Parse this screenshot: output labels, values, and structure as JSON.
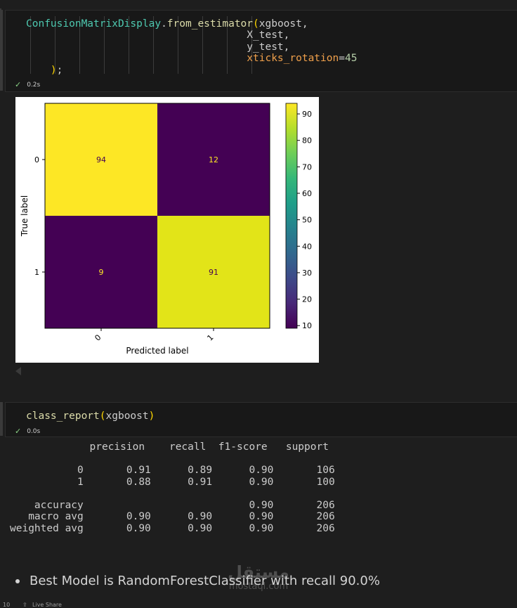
{
  "cell1": {
    "code_lines": [
      {
        "fn": "ConfusionMatrixDisplay",
        "dot": ".",
        "meth": "from_estimator",
        "paren": "(",
        "arg": "xgboost,"
      },
      {
        "arg": "X_test,"
      },
      {
        "arg": "y_test,"
      },
      {
        "kw": "xticks_rotation",
        "eq": "=",
        "num": "45"
      },
      {
        "paren": ")",
        "semi": ";"
      }
    ],
    "status_time": "0.2s"
  },
  "chart_data": {
    "type": "heatmap",
    "title": "",
    "xlabel": "Predicted label",
    "ylabel": "True label",
    "x_ticks": [
      "0",
      "1"
    ],
    "y_ticks": [
      "0",
      "1"
    ],
    "xtick_rotation": 45,
    "matrix": [
      [
        94,
        12
      ],
      [
        9,
        91
      ]
    ],
    "colormap": "viridis",
    "colorbar": {
      "min": 9,
      "max": 94,
      "ticks": [
        10,
        20,
        30,
        40,
        50,
        60,
        70,
        80,
        90
      ]
    },
    "cell_colors": [
      "#fde725",
      "#440154",
      "#440154",
      "#e2e418"
    ],
    "annotation_colors": [
      "#440154",
      "#fde725",
      "#fde725",
      "#440154"
    ]
  },
  "cell2": {
    "code": {
      "meth": "class_report",
      "paren_open": "(",
      "arg": "xgboost",
      "paren_close": ")"
    },
    "status_time": "0.0s"
  },
  "report_text": "             precision    recall  f1-score   support\n\n           0       0.91      0.89      0.90       106\n           1       0.88      0.91      0.90       100\n\n    accuracy                           0.90       206\n   macro avg       0.90      0.90      0.90       206\nweighted avg       0.90      0.90      0.90       206",
  "markdown": {
    "bullet": "Best Model is RandomForestClassifier with recall 90.0%"
  },
  "watermark": {
    "arabic": "مستقل",
    "latin": "mostaql.com"
  },
  "statusbar": {
    "line": "10",
    "liveshare": "Live Share"
  }
}
